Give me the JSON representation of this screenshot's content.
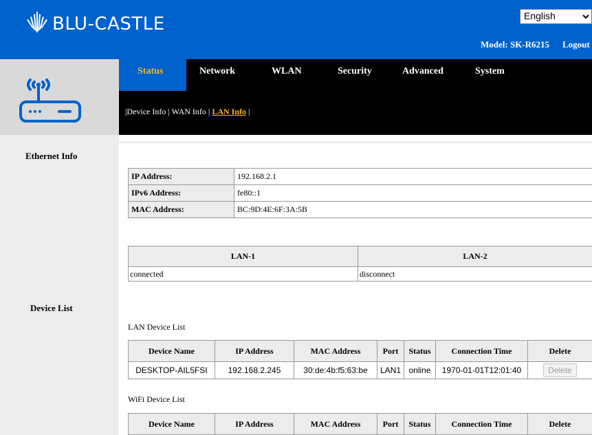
{
  "header": {
    "brand": "BLU-CASTLE",
    "language": "English",
    "model": "Model: SK-R6215",
    "logout": "Logout"
  },
  "nav": {
    "tabs": [
      "Status",
      "Network",
      "WLAN",
      "Security",
      "Advanced",
      "System"
    ],
    "active_tab": "Status",
    "sub": [
      "Device Info",
      "WAN Info",
      "LAN Info"
    ],
    "active_sub": "LAN Info"
  },
  "sidebar": {
    "ethernet_info": "Ethernet Info",
    "device_list": "Device List"
  },
  "ethernet": {
    "rows": [
      {
        "label": "IP Address:",
        "value": "192.168.2.1"
      },
      {
        "label": "IPv6 Address:",
        "value": "fe80::1"
      },
      {
        "label": "MAC Address:",
        "value": "BC:9D:4E:6F:3A:5B"
      }
    ]
  },
  "lan_ports": {
    "headers": [
      "LAN-1",
      "LAN-2"
    ],
    "status": [
      "connected",
      "disconnect"
    ]
  },
  "lan_devices": {
    "title": "LAN Device List",
    "columns": [
      "Device Name",
      "IP Address",
      "MAC Address",
      "Port",
      "Status",
      "Connection Time",
      "Delete"
    ],
    "rows": [
      {
        "name": "DESKTOP-AIL5FSI",
        "ip": "192.168.2.245",
        "mac": "30:de:4b:f5:63:be",
        "port": "LAN1",
        "status": "online",
        "time": "1970-01-01T12:01:40",
        "delete": "Delete"
      }
    ]
  },
  "wifi_devices": {
    "title": "WiFi Device List",
    "columns": [
      "Device Name",
      "IP Address",
      "MAC Address",
      "Port",
      "Status",
      "Connection Time",
      "Delete"
    ]
  },
  "colors": {
    "header_blue": "#0062cc",
    "active_yellow": "#f7b819",
    "nav_black": "#000000",
    "panel_gray": "#d9d9d9"
  }
}
